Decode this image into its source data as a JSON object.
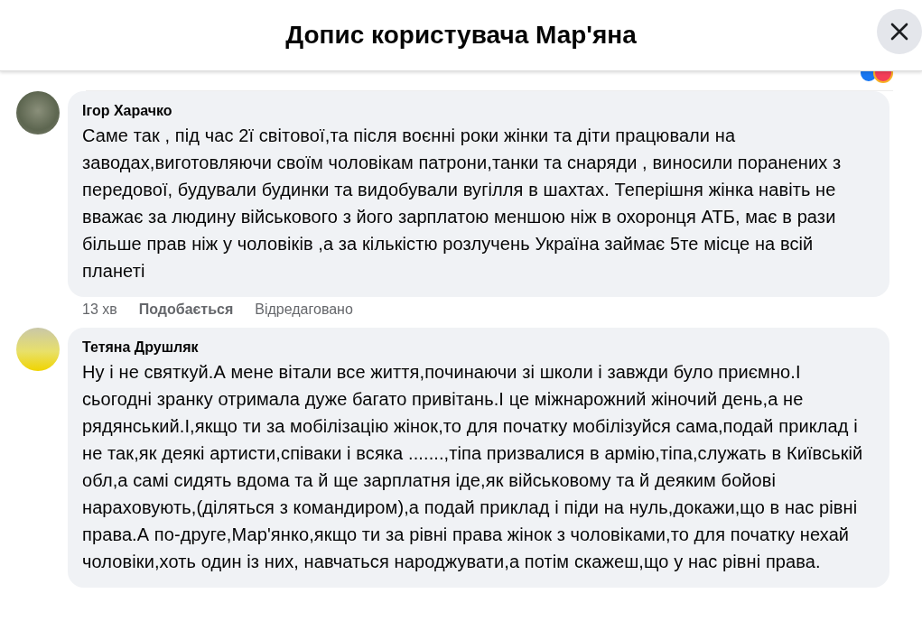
{
  "dialog": {
    "title": "Допис користувача Мар'яна"
  },
  "comments": [
    {
      "author": "Ігор Харачко",
      "text": "Саме так , під час 2ї світової,та після воєнні роки жінки та діти працювали на заводах,виготовляючи своїм чоловікам патрони,танки та снаряди , виносили поранених з передової, будували будинки та видобували вугілля в шахтах. Теперішня жінка навіть не вважає за людину військового з його зарплатою меншою ніж в охоронця АТБ, має в рази більше прав ніж у чоловіків ,а за кількістю розлучень Україна займає 5те місце на всій планеті",
      "time": "13 хв",
      "like": "Подобається",
      "edited": "Відредаговано"
    },
    {
      "author": "Тетяна Друшляк",
      "text": "Ну і не святкуй.А мене вітали все життя,починаючи зі школи і завжди було приємно.І сьогодні зранку отримала дуже багато привітань.І це міжнарожний жіночий день,а не рядянський.І,якщо ти за мобілізацію жінок,то для початку мобілізуйся сама,подай приклад і не так,як деякі артисти,співаки і всяка .......,тіпа призвалися в армію,тіпа,служать в Київській обл,а самі сидять вдома та й ще зарплатня іде,як військовому та й деяким бойові нараховують,(діляться з командиром),а подай приклад і піди на нуль,докажи,що в нас рівні права.А по-друге,Мар'янко,якщо ти за рівні права жінок з чоловіками,то для початку нехай чоловіки,хоть один із них, навчаться народжувати,а потім скажеш,що у нас рівні права."
    }
  ]
}
